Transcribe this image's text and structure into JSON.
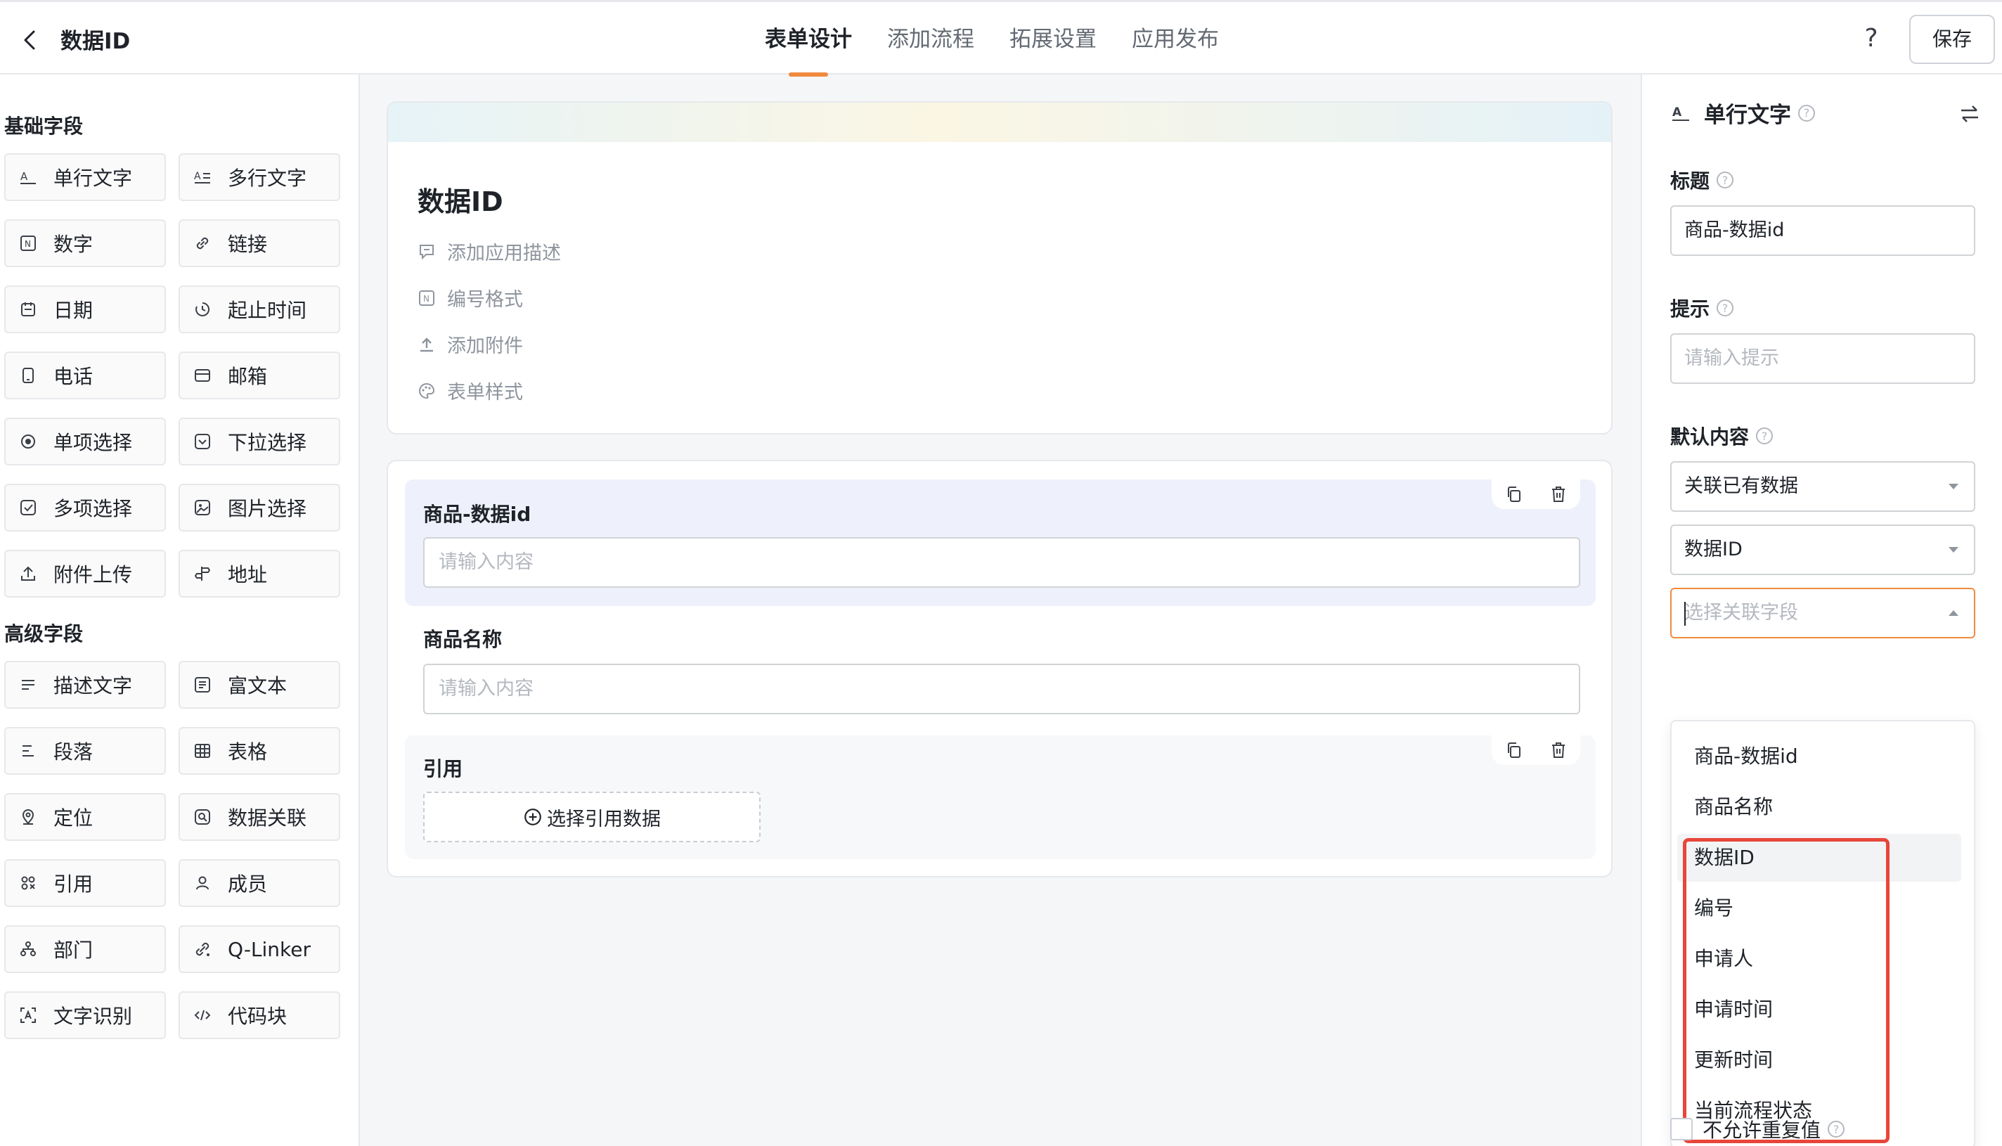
{
  "header": {
    "title": "数据ID",
    "tabs": [
      "表单设计",
      "添加流程",
      "拓展设置",
      "应用发布"
    ],
    "help": "?",
    "save_label": "保存"
  },
  "sidebar": {
    "basic_title": "基础字段",
    "basic_fields": [
      {
        "label": "单行文字",
        "icon": "single-line-text-icon"
      },
      {
        "label": "多行文字",
        "icon": "multi-line-text-icon"
      },
      {
        "label": "数字",
        "icon": "number-icon"
      },
      {
        "label": "链接",
        "icon": "link-icon"
      },
      {
        "label": "日期",
        "icon": "calendar-icon"
      },
      {
        "label": "起止时间",
        "icon": "time-range-icon"
      },
      {
        "label": "电话",
        "icon": "phone-icon"
      },
      {
        "label": "邮箱",
        "icon": "mail-icon"
      },
      {
        "label": "单项选择",
        "icon": "radio-icon"
      },
      {
        "label": "下拉选择",
        "icon": "dropdown-icon"
      },
      {
        "label": "多项选择",
        "icon": "checkbox-icon"
      },
      {
        "label": "图片选择",
        "icon": "image-icon"
      },
      {
        "label": "附件上传",
        "icon": "upload-icon"
      },
      {
        "label": "地址",
        "icon": "address-icon"
      }
    ],
    "advanced_title": "高级字段",
    "advanced_fields": [
      {
        "label": "描述文字",
        "icon": "description-icon"
      },
      {
        "label": "富文本",
        "icon": "rich-text-icon"
      },
      {
        "label": "段落",
        "icon": "paragraph-icon"
      },
      {
        "label": "表格",
        "icon": "table-icon"
      },
      {
        "label": "定位",
        "icon": "location-icon"
      },
      {
        "label": "数据关联",
        "icon": "data-link-icon"
      },
      {
        "label": "引用",
        "icon": "reference-icon"
      },
      {
        "label": "成员",
        "icon": "member-icon"
      },
      {
        "label": "部门",
        "icon": "department-icon"
      },
      {
        "label": "Q-Linker",
        "icon": "q-linker-icon"
      },
      {
        "label": "文字识别",
        "icon": "ocr-icon"
      },
      {
        "label": "代码块",
        "icon": "code-icon"
      }
    ]
  },
  "form": {
    "title": "数据ID",
    "meta": [
      "添加应用描述",
      "编号格式",
      "添加附件",
      "表单样式"
    ],
    "fields": [
      {
        "label": "商品-数据id",
        "placeholder": "请输入内容"
      },
      {
        "label": "商品名称",
        "placeholder": "请输入内容"
      },
      {
        "label": "引用",
        "button": "选择引用数据"
      }
    ]
  },
  "props": {
    "type_label": "单行文字",
    "title_label": "标题",
    "title_value": "商品-数据id",
    "hint_label": "提示",
    "hint_placeholder": "请输入提示",
    "default_label": "默认内容",
    "default_mode": "关联已有数据",
    "linked_form": "数据ID",
    "field_placeholder": "选择关联字段",
    "options": [
      "商品-数据id",
      "商品名称",
      "数据ID",
      "编号",
      "申请人",
      "申请时间",
      "更新时间",
      "当前流程状态"
    ],
    "no_duplicate_label": "不允许重复值"
  },
  "colors": {
    "accent": "#f08a3e",
    "highlight_box": "#e8463a"
  }
}
